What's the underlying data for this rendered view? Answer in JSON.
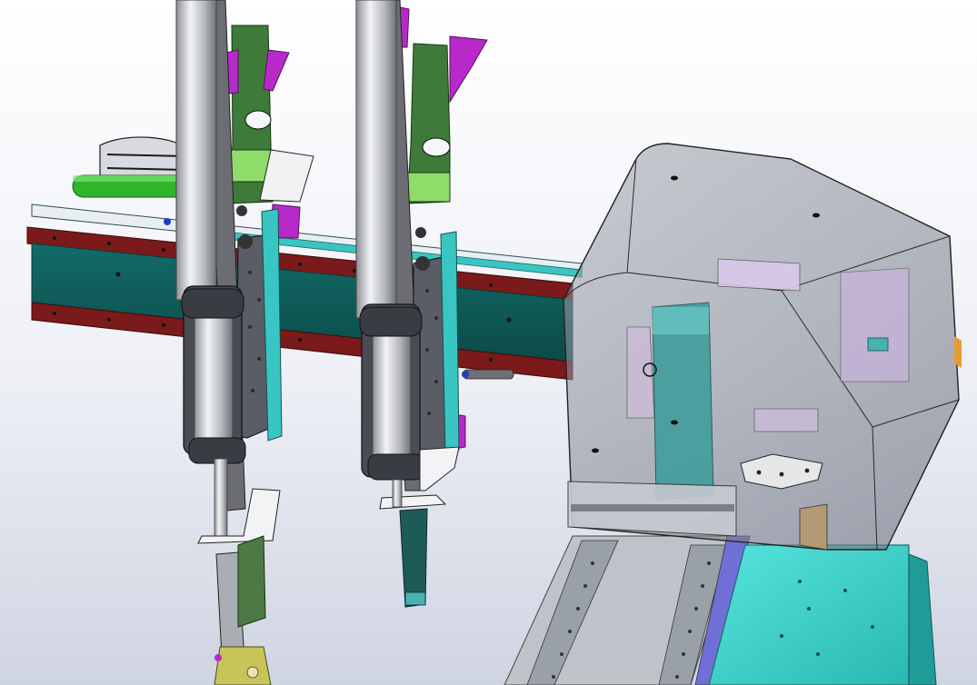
{
  "viewport": {
    "kind": "3D CAD assembly view",
    "background_gradient": [
      "#ffffff",
      "#eef0f6",
      "#cfd4e2"
    ]
  },
  "palette": {
    "rail_teal": "#0e5e5c",
    "rail_red": "#7a1a1a",
    "rack_cyan": "#39c6c2",
    "cylinder_silver": "#c9ccd0",
    "cylinder_shadow": "#7b7f86",
    "carriage_plate": "#5a5c66",
    "bracket_green": "#3e7a3a",
    "bracket_lightgreen": "#8fdc6a",
    "magenta_part": "#b829c9",
    "housing_glass": "#8a8f9a",
    "table_cyan": "#3fd6d0",
    "green_tube": "#2fb52b",
    "yellow_part": "#c9c45a",
    "base_gray": "#a9adb4"
  },
  "icons": {
    "linear_module": "cad-linear-module",
    "housing": "cad-transparent-housing",
    "table": "cad-cyan-table"
  }
}
